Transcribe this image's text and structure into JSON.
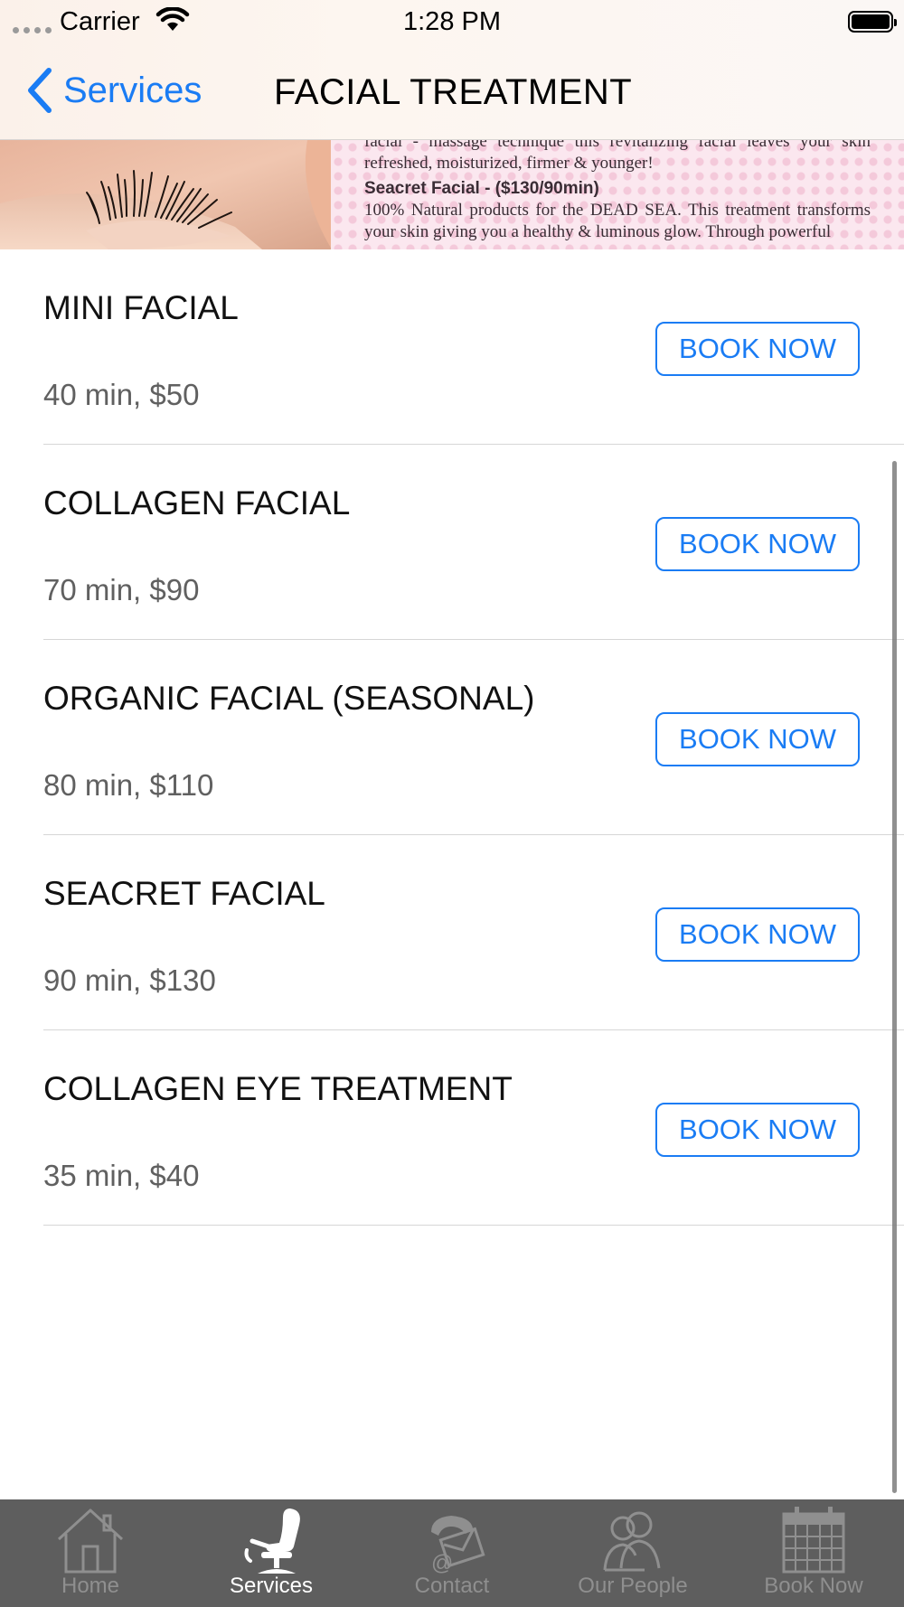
{
  "status_bar": {
    "carrier": "Carrier",
    "time": "1:28 PM"
  },
  "nav": {
    "back_label": "Services",
    "title": "FACIAL TREATMENT"
  },
  "banner": {
    "line1": "facial - massage technique this revitalizing facial leaves your skin refreshed, moisturized, firmer & younger!",
    "heading": "Seacret Facial  -  ($130/90min)",
    "line2": "100% Natural products for the DEAD SEA. This treatment transforms your skin giving you a healthy & luminous glow. Through powerful"
  },
  "services": [
    {
      "name": "MINI FACIAL",
      "detail": "40 min, $50",
      "button": "BOOK NOW"
    },
    {
      "name": "COLLAGEN FACIAL",
      "detail": "70 min, $90",
      "button": "BOOK NOW"
    },
    {
      "name": "ORGANIC FACIAL (SEASONAL)",
      "detail": "80 min, $110",
      "button": "BOOK NOW"
    },
    {
      "name": "SEACRET FACIAL",
      "detail": "90 min, $130",
      "button": "BOOK NOW"
    },
    {
      "name": "COLLAGEN EYE TREATMENT",
      "detail": "35 min, $40",
      "button": "BOOK NOW"
    }
  ],
  "tabs": [
    {
      "label": "Home",
      "icon": "home-icon"
    },
    {
      "label": "Services",
      "icon": "salon-chair-icon",
      "active": true
    },
    {
      "label": "Contact",
      "icon": "phone-mail-icon"
    },
    {
      "label": "Our People",
      "icon": "people-icon"
    },
    {
      "label": "Book Now",
      "icon": "calendar-icon"
    }
  ],
  "colors": {
    "accent": "#1a7cf4",
    "tabbar_bg": "#5e5e5e",
    "tab_inactive": "#8f8f8f",
    "tab_active": "#ffffff"
  }
}
